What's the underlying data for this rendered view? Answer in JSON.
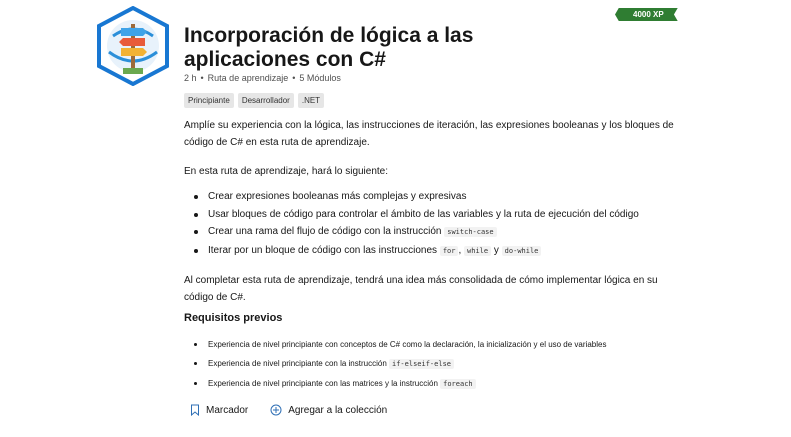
{
  "badge": {
    "icon": "signpost-badge-icon",
    "colors": {
      "ring": "#1877d2",
      "accent": "#2b8fd9"
    }
  },
  "xp": "4000 XP",
  "title": "Incorporación de lógica a las aplicaciones con C#",
  "meta": {
    "duration": "2 h",
    "type": "Ruta de aprendizaje",
    "modules": "5 Módulos"
  },
  "tags": [
    "Principiante",
    "Desarrollador",
    ".NET"
  ],
  "intro": "Amplíe su experiencia con la lógica, las instrucciones de iteración, las expresiones booleanas y los bloques de código de C# en esta ruta de aprendizaje.",
  "lead": "En esta ruta de aprendizaje, hará lo siguiente:",
  "objectives": {
    "item1": "Crear expresiones booleanas más complejas y expresivas",
    "item2": "Usar bloques de código para controlar el ámbito de las variables y la ruta de ejecución del código",
    "item3_text": "Crear una rama del flujo de código con la instrucción",
    "item3_code": "switch-case",
    "item4_text": "Iterar por un bloque de código con las instrucciones",
    "item4_code1": "for",
    "item4_code2": "while",
    "item4_and": "y",
    "item4_code3": "do-while"
  },
  "outcome": "Al completar esta ruta de aprendizaje, tendrá una idea más consolidada de cómo implementar lógica en su código de C#.",
  "prereq": {
    "title": "Requisitos previos",
    "item1": "Experiencia de nivel principiante con conceptos de C# como la declaración, la inicialización y el uso de variables",
    "item2_text": "Experiencia de nivel principiante con la instrucción",
    "item2_code": "if-elseif-else",
    "item3_text": "Experiencia de nivel principiante con las matrices y la instrucción",
    "item3_code": "foreach"
  },
  "actions": {
    "bookmark": "Marcador",
    "add_collection": "Agregar a la colección"
  }
}
